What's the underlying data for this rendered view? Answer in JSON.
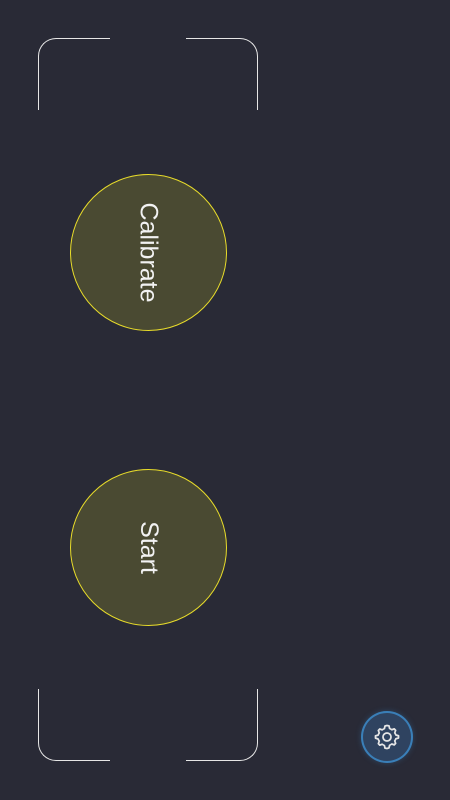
{
  "buttons": {
    "calibrate_label": "Calibrate",
    "start_label": "Start"
  },
  "icons": {
    "settings": "gear-icon"
  },
  "colors": {
    "background": "#292a36",
    "button_fill": "#4a4a32",
    "button_border": "#e8dc2a",
    "settings_ring": "#3a7fb8"
  }
}
